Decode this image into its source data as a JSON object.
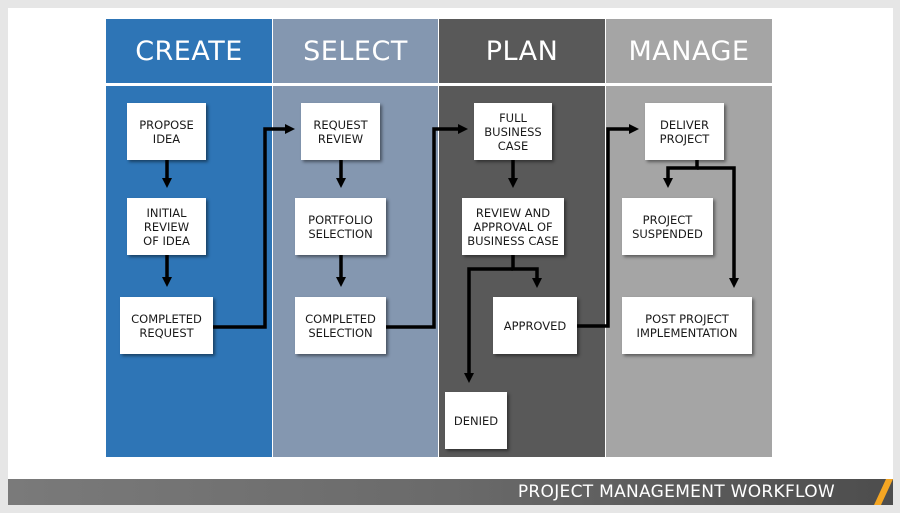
{
  "colors": {
    "create": "#2e75b6",
    "select": "#8497b0",
    "plan": "#595959",
    "manage": "#a5a5a5",
    "accent": "#f5a623",
    "footer": "#5e5e5e"
  },
  "columns": [
    {
      "title": "CREATE"
    },
    {
      "title": "SELECT"
    },
    {
      "title": "PLAN"
    },
    {
      "title": "MANAGE"
    }
  ],
  "boxes": {
    "propose_idea": "PROPOSE\nIDEA",
    "initial_review": "INITIAL\nREVIEW\nOF IDEA",
    "completed_request": "COMPLETED\nREQUEST",
    "request_review": "REQUEST\nREVIEW",
    "portfolio_selection": "PORTFOLIO\nSELECTION",
    "completed_selection": "COMPLETED\nSELECTION",
    "full_business_case": "FULL\nBUSINESS\nCASE",
    "review_approval": "REVIEW AND\nAPPROVAL OF\nBUSINESS CASE",
    "approved": "APPROVED",
    "denied": "DENIED",
    "deliver_project": "DELIVER\nPROJECT",
    "project_suspended": "PROJECT\nSUSPENDED",
    "post_project": "POST PROJECT\nIMPLEMENTATION"
  },
  "footer": {
    "title": "PROJECT MANAGEMENT WORKFLOW",
    "icon": "slash-accent-icon"
  }
}
